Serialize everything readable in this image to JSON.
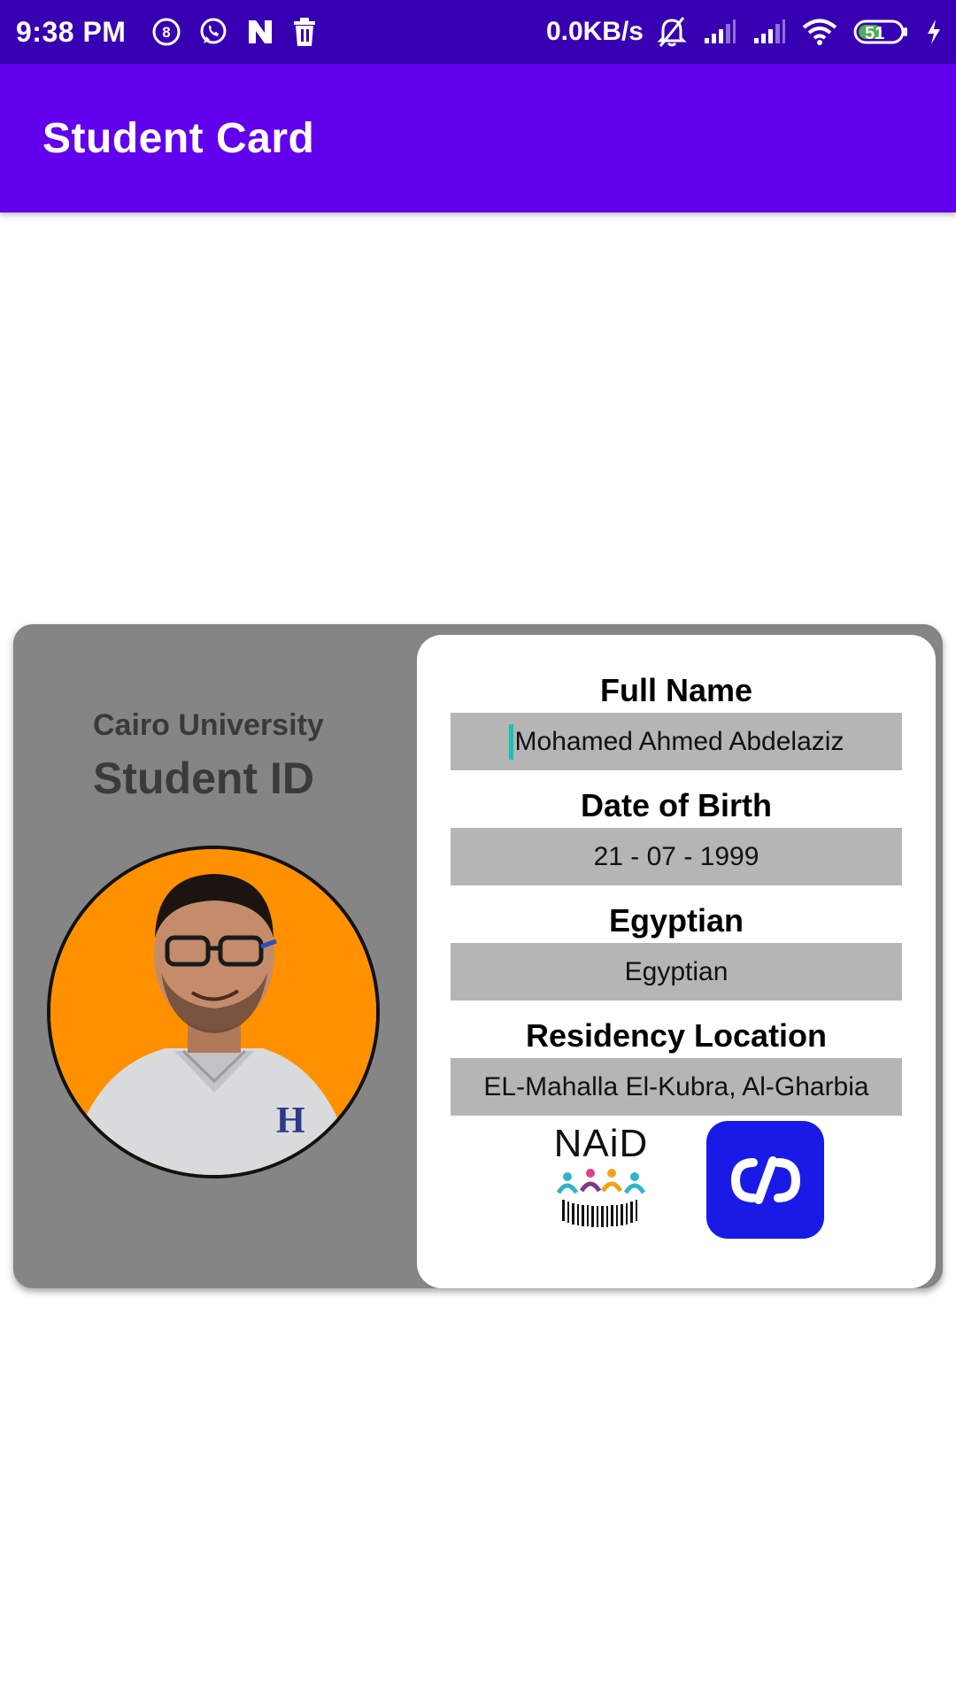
{
  "status_bar": {
    "time": "9:38 PM",
    "network_speed": "0.0KB/s",
    "battery_level": "51",
    "icons": [
      "counter-8-icon",
      "whatsapp-icon",
      "n-app-icon",
      "trash-icon",
      "bell-off-icon",
      "signal-icon",
      "signal-icon",
      "wifi-icon",
      "battery-icon",
      "charging-icon"
    ]
  },
  "app_bar": {
    "title": "Student Card"
  },
  "card": {
    "university": "Cairo University",
    "card_type": "Student ID",
    "photo_background": "#ff9100",
    "fields": [
      {
        "label": "Full Name",
        "value": "Mohamed Ahmed Abdelaziz"
      },
      {
        "label": "Date of Birth",
        "value": "21 - 07 - 1999"
      },
      {
        "label": "Egyptian",
        "value": "Egyptian"
      },
      {
        "label": "Residency Location",
        "value": "EL-Mahalla El-Kubra, Al-Gharbia"
      }
    ],
    "logos": {
      "naid_text": "NAiD"
    }
  },
  "colors": {
    "status_bar": "#3700b3",
    "app_bar": "#6200ee",
    "card_background": "#858585",
    "field_background": "#b5b5b5",
    "app_logo": "#1a1ae6"
  }
}
